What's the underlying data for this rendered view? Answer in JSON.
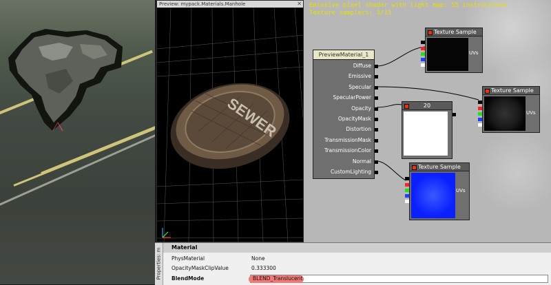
{
  "viewport": {
    "colors": {
      "road_line": "#cfc47a",
      "asphalt": "#424a43"
    }
  },
  "preview": {
    "title": "Preview: mypack.Materials.Manhole",
    "close_glyph": "✕",
    "decal_text": "SEWER"
  },
  "editor": {
    "stats": [
      "Emissive pixel shader with light map: 55 instructions",
      "Texture samplers: 3/13"
    ],
    "preview_material": {
      "title": "PreviewMaterial_1",
      "inputs": [
        "Diffuse",
        "Emissive",
        "Specular",
        "SpecularPower",
        "Opacity",
        "OpacityMask",
        "Distortion",
        "TransmissionMask",
        "TransmissionColor",
        "Normal",
        "CustomLighting"
      ]
    },
    "texture_nodes": [
      {
        "title": "Texture Sample",
        "uv_label": "UVs",
        "tint": "#1a1a1a"
      },
      {
        "title": "Texture Sample",
        "uv_label": "UVs",
        "tint": "#222222"
      },
      {
        "title": "Texture Sample",
        "uv_label": "UVs",
        "tint": "#0a20ff"
      }
    ],
    "constant_node": {
      "value": "20"
    }
  },
  "properties": {
    "tab_label": "Properties: m",
    "section": "Material",
    "rows": [
      {
        "name": "PhysMaterial",
        "value": "None"
      },
      {
        "name": "OpacityMaskClipValue",
        "value": "0.333300"
      },
      {
        "name": "BlendMode",
        "value": "BLEND_Translucent"
      }
    ]
  }
}
